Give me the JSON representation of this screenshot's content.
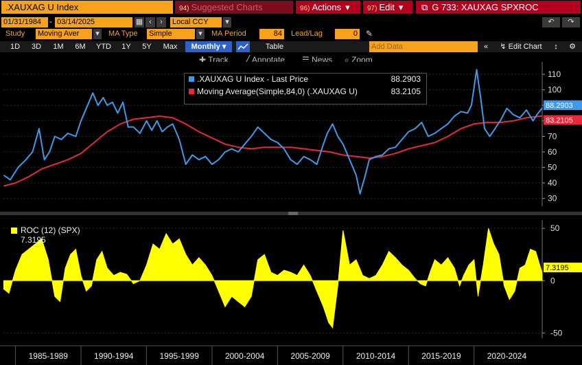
{
  "header": {
    "ticker": ".XAUXAG U Index",
    "suggested_num": "94)",
    "suggested_label": "Suggested Charts",
    "actions_num": "96)",
    "actions_label": "Actions",
    "edit_num": "97)",
    "edit_label": "Edit",
    "title": "G 733: XAUXAG SPXROC"
  },
  "controls": {
    "start_date": "01/31/1984",
    "end_date": "03/14/2025",
    "currency": "Local CCY",
    "study_label": "Study",
    "study_value": "Moving Aver",
    "ma_type_label": "MA Type",
    "ma_type_value": "Simple",
    "ma_period_label": "MA Period",
    "ma_period_value": "84",
    "lead_lag_label": "Lead/Lag",
    "lead_lag_value": "0"
  },
  "periods": [
    "1D",
    "3D",
    "1M",
    "6M",
    "YTD",
    "1Y",
    "5Y",
    "Max",
    "Monthly"
  ],
  "active_period": "Monthly",
  "toolbar": {
    "table": "Table",
    "add_data_placeholder": "Add Data",
    "edit_chart": "Edit Chart",
    "track": "Track",
    "annotate": "Annotate",
    "news": "News",
    "zoom": "Zoom"
  },
  "colors": {
    "price": "#3d9be9",
    "ma": "#e8283c",
    "roc": "#ffff00",
    "accent": "#f7a21b",
    "title_bar": "#b2001e"
  },
  "chart_data": [
    {
      "type": "line",
      "x_labels": [
        "1985-1989",
        "1990-1994",
        "1995-1999",
        "2000-2004",
        "2005-2009",
        "2010-2014",
        "2015-2019",
        "2020-2024"
      ],
      "xlim": [
        1984.08,
        2025.2
      ],
      "ylim": [
        25,
        118
      ],
      "y_ticks": [
        30,
        40,
        50,
        60,
        70,
        80,
        90,
        100,
        110
      ],
      "legend_position": "top-center",
      "series": [
        {
          "name": ".XAUXAG U Index - Last Price",
          "last_value": "88.2903",
          "points": [
            [
              1984.1,
              45
            ],
            [
              1984.6,
              42
            ],
            [
              1985.2,
              50
            ],
            [
              1985.8,
              55
            ],
            [
              1986.3,
              60
            ],
            [
              1986.8,
              75
            ],
            [
              1987.2,
              55
            ],
            [
              1987.6,
              60
            ],
            [
              1988.0,
              70
            ],
            [
              1988.5,
              68
            ],
            [
              1989.0,
              72
            ],
            [
              1989.6,
              70
            ],
            [
              1990.0,
              80
            ],
            [
              1990.5,
              90
            ],
            [
              1990.9,
              98
            ],
            [
              1991.3,
              90
            ],
            [
              1991.7,
              95
            ],
            [
              1992.0,
              90
            ],
            [
              1992.4,
              92
            ],
            [
              1992.8,
              85
            ],
            [
              1993.2,
              92
            ],
            [
              1993.6,
              76
            ],
            [
              1994.0,
              76
            ],
            [
              1994.5,
              72
            ],
            [
              1995.0,
              80
            ],
            [
              1995.4,
              74
            ],
            [
              1995.8,
              80
            ],
            [
              1996.2,
              73
            ],
            [
              1996.6,
              76
            ],
            [
              1997.0,
              78
            ],
            [
              1997.5,
              68
            ],
            [
              1998.0,
              52
            ],
            [
              1998.5,
              58
            ],
            [
              1999.0,
              55
            ],
            [
              1999.5,
              57
            ],
            [
              2000.0,
              52
            ],
            [
              2000.5,
              55
            ],
            [
              2001.0,
              60
            ],
            [
              2001.5,
              62
            ],
            [
              2002.0,
              60
            ],
            [
              2002.5,
              65
            ],
            [
              2003.0,
              70
            ],
            [
              2003.5,
              76
            ],
            [
              2004.0,
              72
            ],
            [
              2004.5,
              68
            ],
            [
              2005.0,
              66
            ],
            [
              2005.5,
              62
            ],
            [
              2006.0,
              55
            ],
            [
              2006.5,
              52
            ],
            [
              2007.0,
              57
            ],
            [
              2007.5,
              55
            ],
            [
              2008.0,
              52
            ],
            [
              2008.5,
              65
            ],
            [
              2008.8,
              72
            ],
            [
              2009.2,
              78
            ],
            [
              2009.6,
              70
            ],
            [
              2010.0,
              65
            ],
            [
              2010.5,
              55
            ],
            [
              2011.0,
              45
            ],
            [
              2011.3,
              33
            ],
            [
              2011.7,
              45
            ],
            [
              2012.0,
              55
            ],
            [
              2012.5,
              57
            ],
            [
              2013.0,
              58
            ],
            [
              2013.5,
              62
            ],
            [
              2014.0,
              63
            ],
            [
              2014.5,
              68
            ],
            [
              2015.0,
              73
            ],
            [
              2015.5,
              75
            ],
            [
              2016.0,
              79
            ],
            [
              2016.5,
              70
            ],
            [
              2017.0,
              72
            ],
            [
              2017.5,
              75
            ],
            [
              2018.0,
              78
            ],
            [
              2018.5,
              83
            ],
            [
              2019.0,
              86
            ],
            [
              2019.5,
              85
            ],
            [
              2019.8,
              90
            ],
            [
              2020.2,
              113
            ],
            [
              2020.5,
              95
            ],
            [
              2020.8,
              75
            ],
            [
              2021.2,
              70
            ],
            [
              2021.6,
              75
            ],
            [
              2022.0,
              80
            ],
            [
              2022.5,
              88
            ],
            [
              2023.0,
              84
            ],
            [
              2023.5,
              82
            ],
            [
              2024.0,
              87
            ],
            [
              2024.5,
              80
            ],
            [
              2024.8,
              84
            ],
            [
              2025.2,
              88.29
            ]
          ]
        },
        {
          "name": "Moving Average(Simple,84,0) (.XAUXAG U)",
          "last_value": "83.2105",
          "points": [
            [
              1984.1,
              38
            ],
            [
              1985.0,
              40
            ],
            [
              1986.0,
              44
            ],
            [
              1987.0,
              49
            ],
            [
              1988.0,
              52
            ],
            [
              1989.0,
              55
            ],
            [
              1990.0,
              59
            ],
            [
              1991.0,
              66
            ],
            [
              1992.0,
              73
            ],
            [
              1993.0,
              78
            ],
            [
              1994.0,
              81
            ],
            [
              1995.0,
              82
            ],
            [
              1996.0,
              83
            ],
            [
              1997.0,
              82
            ],
            [
              1998.0,
              78
            ],
            [
              1999.0,
              73
            ],
            [
              2000.0,
              69
            ],
            [
              2001.0,
              65
            ],
            [
              2002.0,
              63
            ],
            [
              2003.0,
              62
            ],
            [
              2004.0,
              63
            ],
            [
              2005.0,
              63
            ],
            [
              2006.0,
              63
            ],
            [
              2007.0,
              62
            ],
            [
              2008.0,
              61
            ],
            [
              2009.0,
              60
            ],
            [
              2010.0,
              58
            ],
            [
              2011.0,
              57
            ],
            [
              2012.0,
              56
            ],
            [
              2013.0,
              57
            ],
            [
              2014.0,
              59
            ],
            [
              2015.0,
              62
            ],
            [
              2016.0,
              64
            ],
            [
              2017.0,
              66
            ],
            [
              2018.0,
              70
            ],
            [
              2019.0,
              75
            ],
            [
              2020.0,
              78
            ],
            [
              2021.0,
              79
            ],
            [
              2022.0,
              79
            ],
            [
              2023.0,
              80
            ],
            [
              2024.0,
              82
            ],
            [
              2025.2,
              83.21
            ]
          ]
        }
      ]
    },
    {
      "type": "area",
      "ylim": [
        -55,
        58
      ],
      "y_ticks": [
        -50,
        0,
        50
      ],
      "legend_position": "top-left",
      "series": [
        {
          "name": "ROC (12) (SPX)",
          "last_value": "7.3195",
          "points": [
            [
              1984.1,
              -8
            ],
            [
              1984.5,
              -12
            ],
            [
              1985.0,
              10
            ],
            [
              1985.5,
              25
            ],
            [
              1986.0,
              30
            ],
            [
              1986.5,
              35
            ],
            [
              1987.0,
              40
            ],
            [
              1987.5,
              20
            ],
            [
              1988.0,
              -15
            ],
            [
              1988.4,
              -20
            ],
            [
              1988.8,
              12
            ],
            [
              1989.2,
              25
            ],
            [
              1989.6,
              30
            ],
            [
              1990.0,
              5
            ],
            [
              1990.4,
              -10
            ],
            [
              1990.8,
              -5
            ],
            [
              1991.2,
              20
            ],
            [
              1991.6,
              28
            ],
            [
              1992.0,
              12
            ],
            [
              1992.5,
              5
            ],
            [
              1993.0,
              8
            ],
            [
              1993.5,
              6
            ],
            [
              1994.0,
              -3
            ],
            [
              1994.5,
              0
            ],
            [
              1995.0,
              15
            ],
            [
              1995.5,
              35
            ],
            [
              1996.0,
              30
            ],
            [
              1996.5,
              45
            ],
            [
              1997.0,
              35
            ],
            [
              1997.5,
              40
            ],
            [
              1998.0,
              25
            ],
            [
              1998.5,
              15
            ],
            [
              1999.0,
              22
            ],
            [
              1999.5,
              15
            ],
            [
              2000.0,
              5
            ],
            [
              2000.5,
              -10
            ],
            [
              2001.0,
              -25
            ],
            [
              2001.5,
              -15
            ],
            [
              2002.0,
              -20
            ],
            [
              2002.5,
              -25
            ],
            [
              2003.0,
              -15
            ],
            [
              2003.5,
              20
            ],
            [
              2004.0,
              25
            ],
            [
              2004.5,
              8
            ],
            [
              2005.0,
              5
            ],
            [
              2005.5,
              10
            ],
            [
              2006.0,
              8
            ],
            [
              2006.5,
              5
            ],
            [
              2007.0,
              15
            ],
            [
              2007.5,
              5
            ],
            [
              2008.0,
              -10
            ],
            [
              2008.5,
              -25
            ],
            [
              2008.9,
              -40
            ],
            [
              2009.2,
              -45
            ],
            [
              2009.6,
              -5
            ],
            [
              2010.0,
              48
            ],
            [
              2010.5,
              15
            ],
            [
              2011.0,
              20
            ],
            [
              2011.5,
              5
            ],
            [
              2012.0,
              2
            ],
            [
              2012.5,
              5
            ],
            [
              2013.0,
              15
            ],
            [
              2013.5,
              28
            ],
            [
              2014.0,
              22
            ],
            [
              2014.5,
              15
            ],
            [
              2015.0,
              10
            ],
            [
              2015.5,
              2
            ],
            [
              2015.9,
              -3
            ],
            [
              2016.3,
              -5
            ],
            [
              2016.7,
              10
            ],
            [
              2017.0,
              20
            ],
            [
              2017.5,
              15
            ],
            [
              2018.0,
              22
            ],
            [
              2018.5,
              12
            ],
            [
              2018.9,
              -5
            ],
            [
              2019.2,
              5
            ],
            [
              2019.6,
              15
            ],
            [
              2020.0,
              20
            ],
            [
              2020.3,
              -15
            ],
            [
              2020.7,
              15
            ],
            [
              2021.1,
              50
            ],
            [
              2021.5,
              35
            ],
            [
              2021.9,
              25
            ],
            [
              2022.3,
              -5
            ],
            [
              2022.7,
              -18
            ],
            [
              2023.1,
              -10
            ],
            [
              2023.5,
              12
            ],
            [
              2023.9,
              15
            ],
            [
              2024.3,
              30
            ],
            [
              2024.7,
              28
            ],
            [
              2025.2,
              7.32
            ]
          ]
        }
      ]
    }
  ]
}
